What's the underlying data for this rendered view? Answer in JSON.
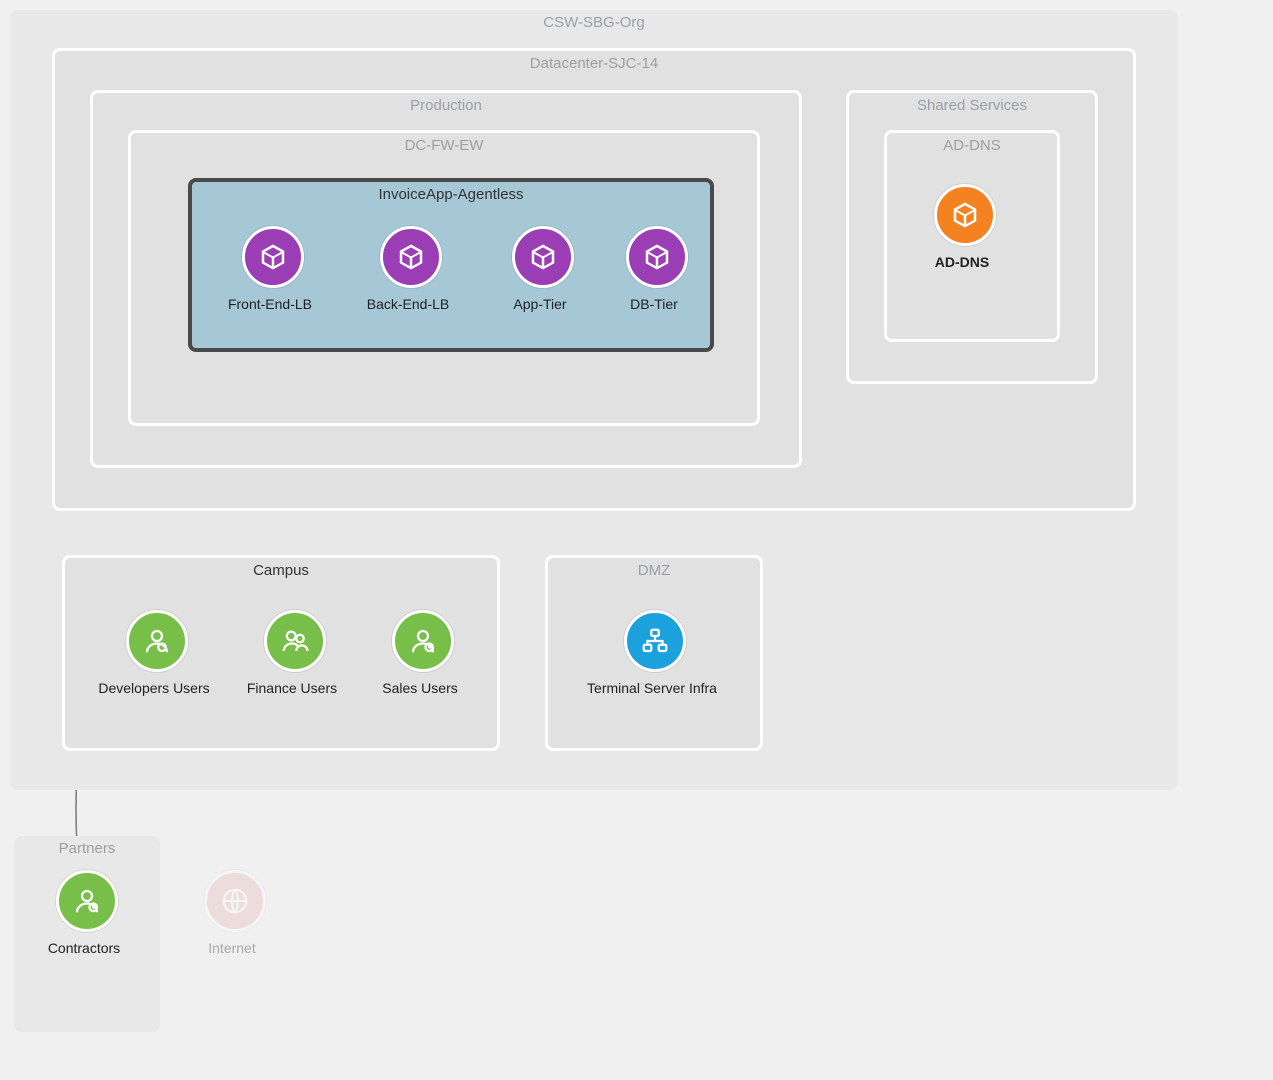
{
  "colors": {
    "purple": "#9b3db5",
    "orange": "#f58220",
    "green": "#78bf4a",
    "blue": "#1da1dd",
    "pink": "#e8b8b8",
    "selectedFill": "#a6c8d6",
    "selectedStroke": "#4a4a4a",
    "scopeFill": "#e1e1e1",
    "scopeStroke": "#ffffff",
    "orgFill": "#e8e8e8",
    "labelGrey": "#9aa0a6"
  },
  "scopes": {
    "org": "CSW-SBG-Org",
    "datacenter": "Datacenter-SJC-14",
    "production": "Production",
    "dcfw": "DC-FW-EW",
    "invoiceApp": "InvoiceApp-Agentless",
    "sharedServices": "Shared Services",
    "addns": "AD-DNS",
    "campus": "Campus",
    "dmz": "DMZ",
    "partners": "Partners"
  },
  "nodes": {
    "frontEnd": "Front-End-LB",
    "backEnd": "Back-End-LB",
    "appTier": "App-Tier",
    "dbTier": "DB-Tier",
    "addns": "AD-DNS",
    "devUsers": "Developers Users",
    "finUsers": "Finance Users",
    "salesUsers": "Sales Users",
    "terminal": "Terminal Server Infra",
    "contractors": "Contractors",
    "internet": "Internet"
  }
}
